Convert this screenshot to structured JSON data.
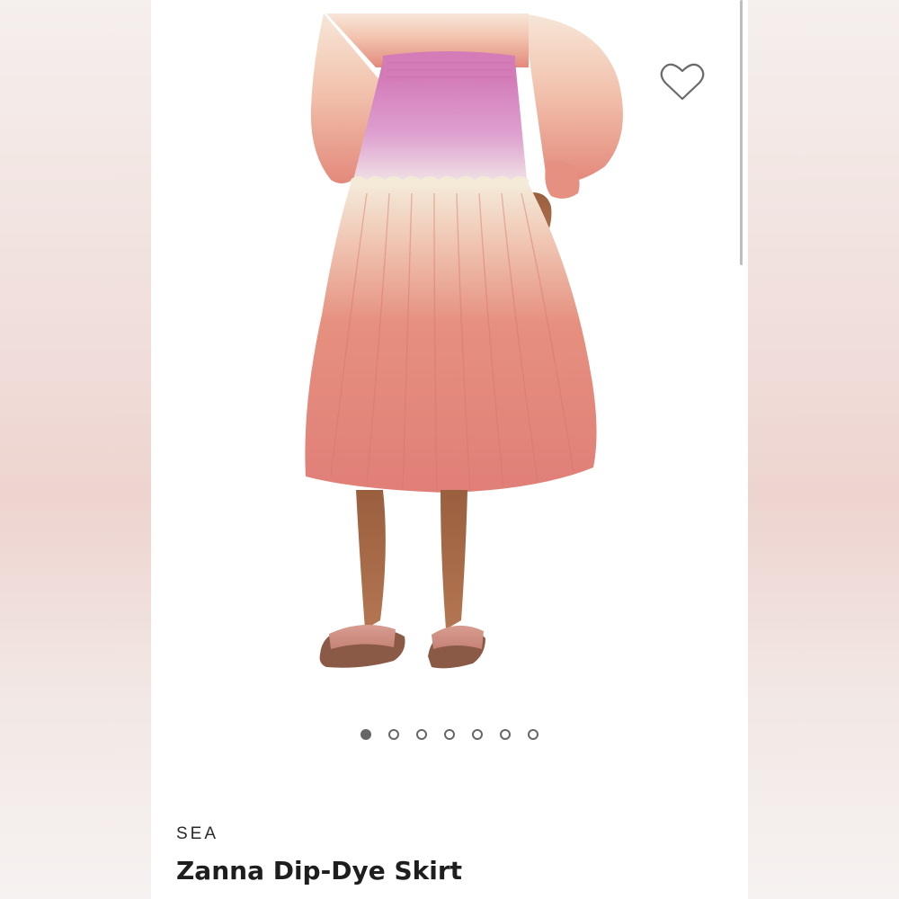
{
  "product": {
    "brand": "SEA",
    "name": "Zanna Dip-Dye Skirt",
    "image_alt_icon": "product-photo"
  },
  "gallery": {
    "total_images": 7,
    "active_index": 0
  },
  "icons": {
    "wishlist": "heart-outline-icon"
  },
  "colors": {
    "dot_active": "#666666",
    "skirt_coral": "#e48a7f",
    "skirt_pink": "#d78bbd",
    "skirt_cream": "#f3e3d4"
  }
}
